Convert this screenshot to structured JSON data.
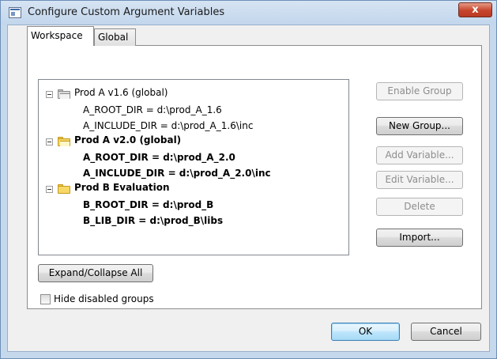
{
  "window": {
    "title": "Configure Custom Argument Variables",
    "close_label": "x"
  },
  "tabs": [
    {
      "label": "Workspace",
      "active": true
    },
    {
      "label": "Global",
      "active": false
    }
  ],
  "tree": {
    "groups": [
      {
        "label": "Prod A v1.6 (global)",
        "enabled": false,
        "expanded": true,
        "folder": "gray-open",
        "variables": [
          "A_ROOT_DIR  =  d:\\prod_A_1.6",
          "A_INCLUDE_DIR  =  d:\\prod_A_1.6\\inc"
        ]
      },
      {
        "label": "Prod A v2.0 (global)",
        "enabled": true,
        "expanded": true,
        "folder": "yellow-open",
        "variables": [
          "A_ROOT_DIR  =  d:\\prod_A_2.0",
          "A_INCLUDE_DIR  =  d:\\prod_A_2.0\\inc"
        ]
      },
      {
        "label": "Prod B Evaluation",
        "enabled": true,
        "expanded": true,
        "folder": "yellow",
        "variables": [
          "B_ROOT_DIR  =  d:\\prod_B",
          "B_LIB_DIR  =  d:\\prod_B\\libs"
        ]
      }
    ]
  },
  "buttons": {
    "enable_group": "Enable Group",
    "new_group": "New Group...",
    "add_variable": "Add Variable...",
    "edit_variable": "Edit Variable...",
    "delete": "Delete",
    "import": "Import...",
    "expand_collapse_all": "Expand/Collapse All",
    "ok": "OK",
    "cancel": "Cancel"
  },
  "options": {
    "hide_disabled_groups": {
      "label": "Hide disabled groups",
      "checked": false
    }
  },
  "colors": {
    "titlebar": "#c6d8ec",
    "close_button": "#c7442b",
    "default_button_border": "#3c7fb1",
    "disabled_text": "#8d8d8d"
  }
}
